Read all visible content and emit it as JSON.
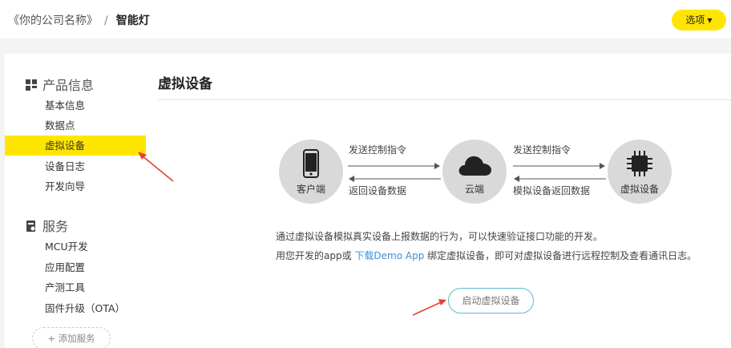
{
  "header": {
    "company": "《你的公司名称》",
    "separator": "/",
    "product": "智能灯",
    "options_label": "选项",
    "options_caret": "▼"
  },
  "sidebar": {
    "group1_title": "产品信息",
    "group1_items": [
      "基本信息",
      "数据点",
      "虚拟设备",
      "设备日志",
      "开发向导"
    ],
    "active_item": "虚拟设备",
    "group2_title": "服务",
    "group2_items": [
      "MCU开发",
      "应用配置",
      "产测工具",
      "固件升级（OTA）"
    ],
    "add_service": "+ 添加服务"
  },
  "main": {
    "title": "虚拟设备",
    "diagram": {
      "client": "客户端",
      "cloud": "云端",
      "virtual": "虚拟设备",
      "send1": "发送控制指令",
      "return1": "返回设备数据",
      "send2": "发送控制指令",
      "return2": "模拟设备返回数据"
    },
    "desc1": "通过虚拟设备模拟真实设备上报数据的行为，可以快速验证接口功能的开发。",
    "desc2_prefix": "用您开发的app或",
    "desc2_link": "下载Demo App",
    "desc2_suffix": "绑定虚拟设备，即可对虚拟设备进行远程控制及查看通讯日志。",
    "start_button": "启动虚拟设备"
  },
  "colors": {
    "accent": "#ffe600",
    "link": "#3d8fd6",
    "button_border": "#5fb9cf",
    "annotation": "#e8412c"
  }
}
